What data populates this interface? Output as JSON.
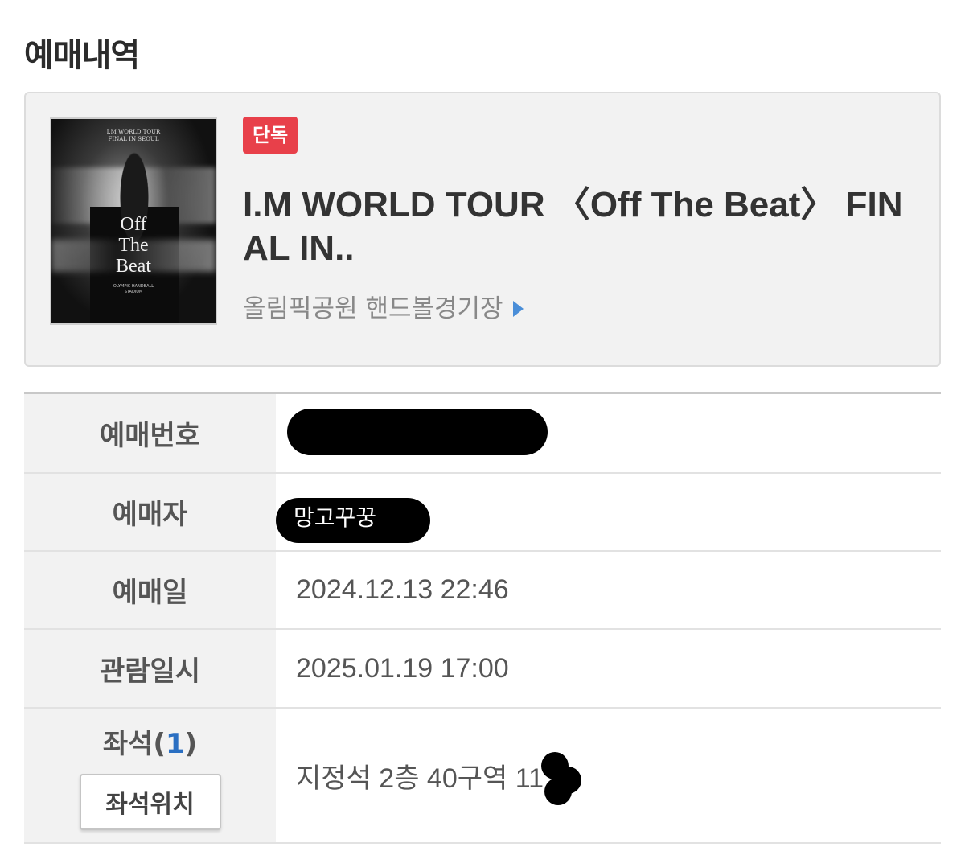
{
  "page": {
    "title": "예매내역"
  },
  "event": {
    "badge": "단독",
    "title": "I.M WORLD TOUR 〈Off The Beat〉 FINAL IN..",
    "venue": "올림픽공원 핸드볼경기장",
    "poster": {
      "header_line1": "I.M WORLD TOUR",
      "header_line2": "FINAL IN SEOUL",
      "title_line1": "Off",
      "title_line2": "The",
      "title_line3": "Beat",
      "venue_line1": "OLYMPIC HANDBALL",
      "venue_line2": "STADIUM"
    }
  },
  "details": {
    "booking_number_label": "예매번호",
    "booker_label": "예매자",
    "booker_value": "망고꾸꿍",
    "booking_date_label": "예매일",
    "booking_date_value": "2024.12.13 22:46",
    "viewing_date_label": "관람일시",
    "viewing_date_value": "2025.01.19 17:00",
    "seat_label": "좌석",
    "seat_count": "1",
    "seat_value": "지정석 2층 40구역 11",
    "seat_location_button": "좌석위치"
  },
  "colors": {
    "badge": "#e8404a",
    "venue_arrow": "#4a8ed8",
    "seat_count": "#2a6fc2",
    "label_bg": "#f2f2f2"
  },
  "icons": {
    "venue_arrow": "triangle-right-icon"
  }
}
